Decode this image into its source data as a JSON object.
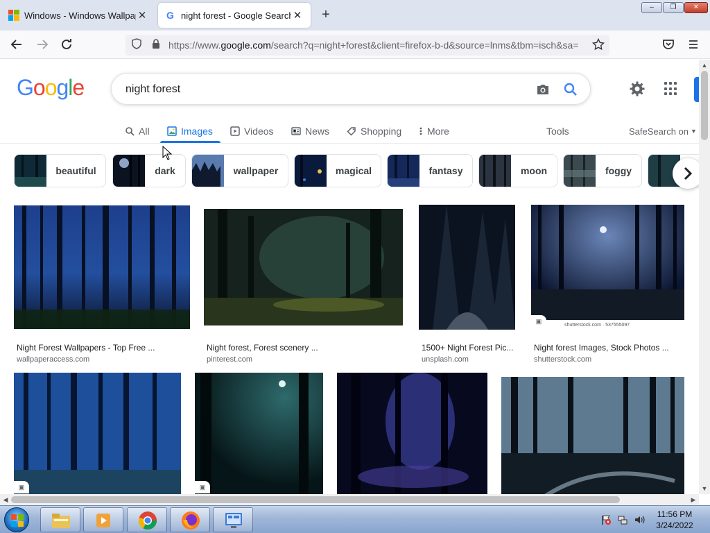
{
  "browser": {
    "tabs": [
      {
        "title": "Windows - Windows Wallpaper",
        "active": false
      },
      {
        "title": "night forest - Google Search",
        "active": true
      }
    ],
    "url": {
      "prefix": "https://www.",
      "host": "google.com",
      "path": "/search?q=night+forest&client=firefox-b-d&source=lnms&tbm=isch&sa="
    },
    "window_controls": {
      "minimize": "–",
      "restore": "❐",
      "close": "✕"
    }
  },
  "google": {
    "logo": [
      "G",
      "o",
      "o",
      "g",
      "l",
      "e"
    ],
    "logo_colors": [
      "#4285F4",
      "#EA4335",
      "#FBBC05",
      "#4285F4",
      "#34A853",
      "#EA4335"
    ],
    "query": "night forest",
    "tabs": [
      {
        "label": "All",
        "icon": "search-icon"
      },
      {
        "label": "Images",
        "icon": "image-icon",
        "active": true
      },
      {
        "label": "Videos",
        "icon": "play-icon"
      },
      {
        "label": "News",
        "icon": "news-icon"
      },
      {
        "label": "Shopping",
        "icon": "tag-icon"
      },
      {
        "label": "More",
        "icon": "more-vert-icon"
      }
    ],
    "tools": "Tools",
    "safesearch": "SafeSearch on",
    "chips": [
      "beautiful",
      "dark",
      "wallpaper",
      "magical",
      "fantasy",
      "moon",
      "foggy"
    ],
    "results": [
      {
        "title": "Night Forest Wallpapers - Top Free ...",
        "source": "wallpaperaccess.com"
      },
      {
        "title": "Night forest, Forest scenery ...",
        "source": "pinterest.com"
      },
      {
        "title": "1500+ Night Forest Pic...",
        "source": "unsplash.com"
      },
      {
        "title": "Night forest Images, Stock Photos ...",
        "source": "shutterstock.com",
        "watermark": "shutterstock.com · 537555097"
      }
    ],
    "accent": "#1a73e8"
  },
  "taskbar": {
    "time": "11:56 PM",
    "date": "3/24/2022",
    "apps": [
      "file-explorer-icon",
      "media-player-icon",
      "chrome-icon",
      "firefox-icon",
      "control-panel-icon"
    ]
  }
}
